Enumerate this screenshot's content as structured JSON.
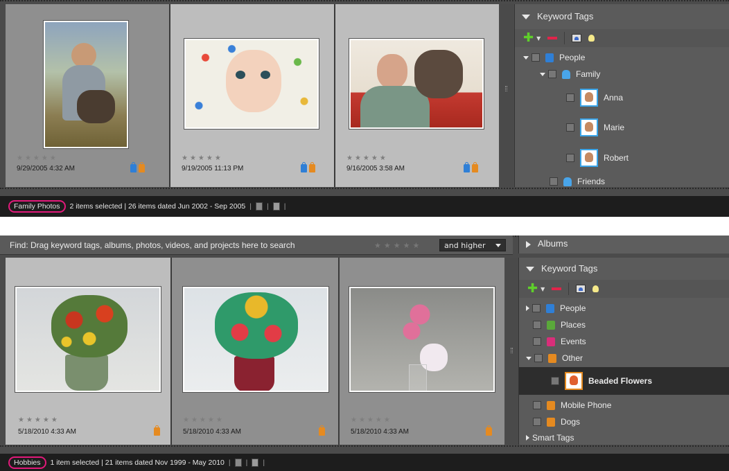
{
  "top": {
    "cells": [
      {
        "stars": "★★★★★",
        "date": "9/29/2005 4:32 AM",
        "badges": [
          "blue",
          "orange"
        ]
      },
      {
        "stars": "★★★★★",
        "date": "9/19/2005 11:13 PM",
        "badges": [
          "blue",
          "orange"
        ]
      },
      {
        "stars": "★★★★★",
        "date": "9/16/2005 3:58 AM",
        "badges": [
          "blue",
          "orange"
        ]
      }
    ],
    "keyword_panel": {
      "title": "Keyword Tags",
      "tree": [
        {
          "label": "People",
          "icon": "people-tag-icon"
        },
        {
          "label": "Family",
          "icon": "family-tag-icon"
        },
        {
          "label": "Anna",
          "icon": "face-thumbnail-icon"
        },
        {
          "label": "Marie",
          "icon": "face-thumbnail-icon"
        },
        {
          "label": "Robert",
          "icon": "face-thumbnail-icon"
        },
        {
          "label": "Friends",
          "icon": "family-tag-icon"
        }
      ]
    },
    "status": {
      "album": "Family Photos",
      "text": "2 items selected | 26 items dated Jun 2002 - Sep 2005"
    }
  },
  "bottom": {
    "find": {
      "text": "Find: Drag keyword tags, albums, photos, videos, and projects here to search",
      "stars": "★★★★★",
      "select_value": "and higher"
    },
    "cells": [
      {
        "stars": "★★★★★",
        "date": "5/18/2010 4:33 AM",
        "badges": [
          "orange"
        ]
      },
      {
        "stars": "★★★★★",
        "date": "5/18/2010 4:33 AM",
        "badges": [
          "orange"
        ]
      },
      {
        "stars": "★★★★★",
        "date": "5/18/2010 4:33 AM",
        "badges": [
          "orange"
        ]
      }
    ],
    "albums_title": "Albums",
    "keyword_panel": {
      "title": "Keyword Tags",
      "tree": [
        {
          "label": "People",
          "icon": "people-tag-icon"
        },
        {
          "label": "Places",
          "icon": "places-tag-icon"
        },
        {
          "label": "Events",
          "icon": "events-tag-icon"
        },
        {
          "label": "Other",
          "icon": "other-tag-icon"
        },
        {
          "label": "Beaded Flowers",
          "icon": "flower-thumbnail-icon"
        },
        {
          "label": "Mobile Phone",
          "icon": "other-tag-icon"
        },
        {
          "label": "Dogs",
          "icon": "other-tag-icon"
        },
        {
          "label": "Smart Tags",
          "icon": "expand-icon"
        }
      ]
    },
    "status": {
      "album": "Hobbies",
      "text": "1 item selected | 21 items dated Nov 1999 - May 2010"
    }
  },
  "colors": {
    "selection_highlight": "#e2197a",
    "add_tag": "#5fcf2b",
    "remove_tag": "#e0244a"
  }
}
